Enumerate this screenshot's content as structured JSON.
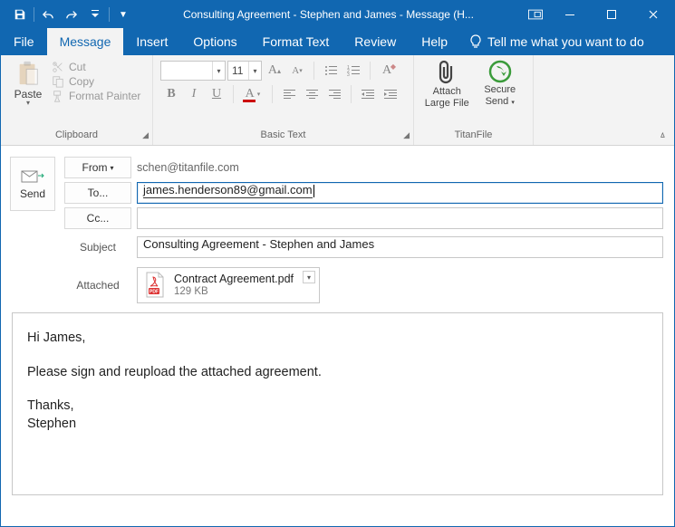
{
  "window": {
    "title": "Consulting Agreement - Stephen and James  -  Message (H..."
  },
  "tabs": {
    "file": "File",
    "message": "Message",
    "insert": "Insert",
    "options": "Options",
    "format_text": "Format Text",
    "review": "Review",
    "help": "Help",
    "tell_me": "Tell me what you want to do"
  },
  "ribbon": {
    "clipboard": {
      "paste": "Paste",
      "cut": "Cut",
      "copy": "Copy",
      "format_painter": "Format Painter",
      "group_label": "Clipboard"
    },
    "basic_text": {
      "font_name": "",
      "font_size": "11",
      "group_label": "Basic Text"
    },
    "titanfile": {
      "attach_large_file_l1": "Attach",
      "attach_large_file_l2": "Large File",
      "secure_send_l1": "Secure",
      "secure_send_l2": "Send",
      "group_label": "TitanFile"
    }
  },
  "compose": {
    "send": "Send",
    "from_button": "From",
    "from_value": "schen@titanfile.com",
    "to_button": "To...",
    "to_value": "james.henderson89@gmail.com",
    "cc_button": "Cc...",
    "cc_value": "",
    "subject_label": "Subject",
    "subject_value": "Consulting Agreement - Stephen and James",
    "attached_label": "Attached",
    "attachment": {
      "name": "Contract Agreement.pdf",
      "size": "129 KB"
    }
  },
  "body": {
    "line1": "Hi James,",
    "line2": "Please sign and reupload the attached agreement.",
    "line3": "Thanks,",
    "line4": "Stephen"
  }
}
